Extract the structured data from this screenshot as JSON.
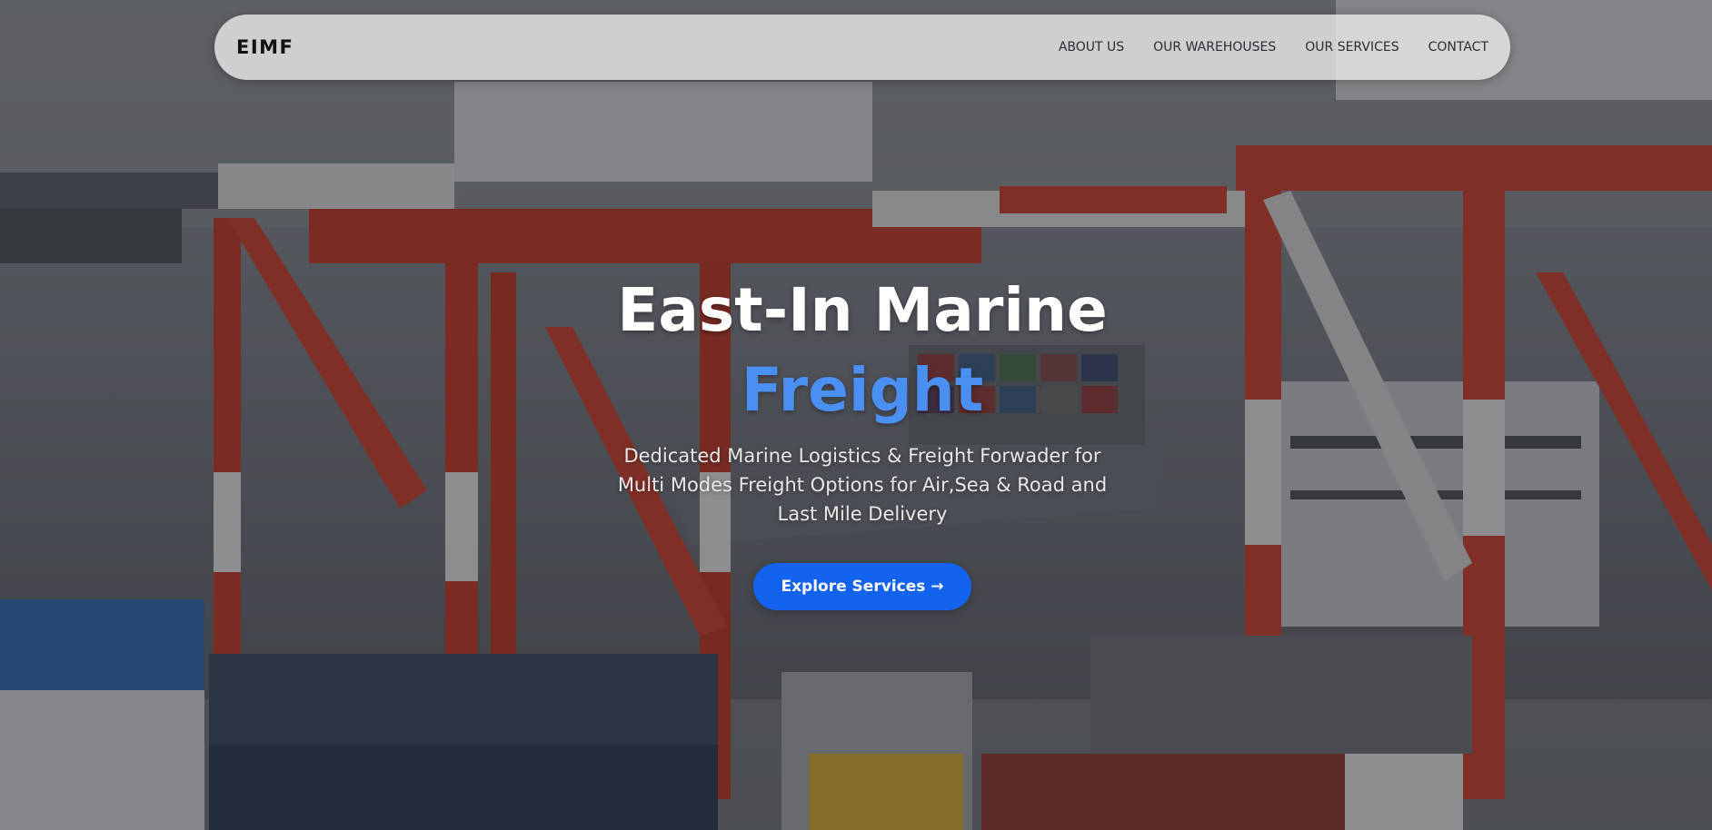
{
  "nav": {
    "brand": "EIMF",
    "links": [
      "ABOUT US",
      "OUR WAREHOUSES",
      "OUR SERVICES",
      "CONTACT"
    ]
  },
  "hero": {
    "title_line1": "East-In Marine",
    "title_line2": "Freight",
    "subtitle": "Dedicated Marine Logistics & Freight Forwader for Multi Modes Freight Options for Air,Sea & Road and Last Mile Delivery",
    "cta_label": "Explore Services →",
    "background_image": "port-cranes-container-ship"
  },
  "colors": {
    "accent": "#4a8ff2",
    "button": "#1463ef",
    "navbar": "#e8e8e8",
    "text_light": "#ffffff"
  }
}
